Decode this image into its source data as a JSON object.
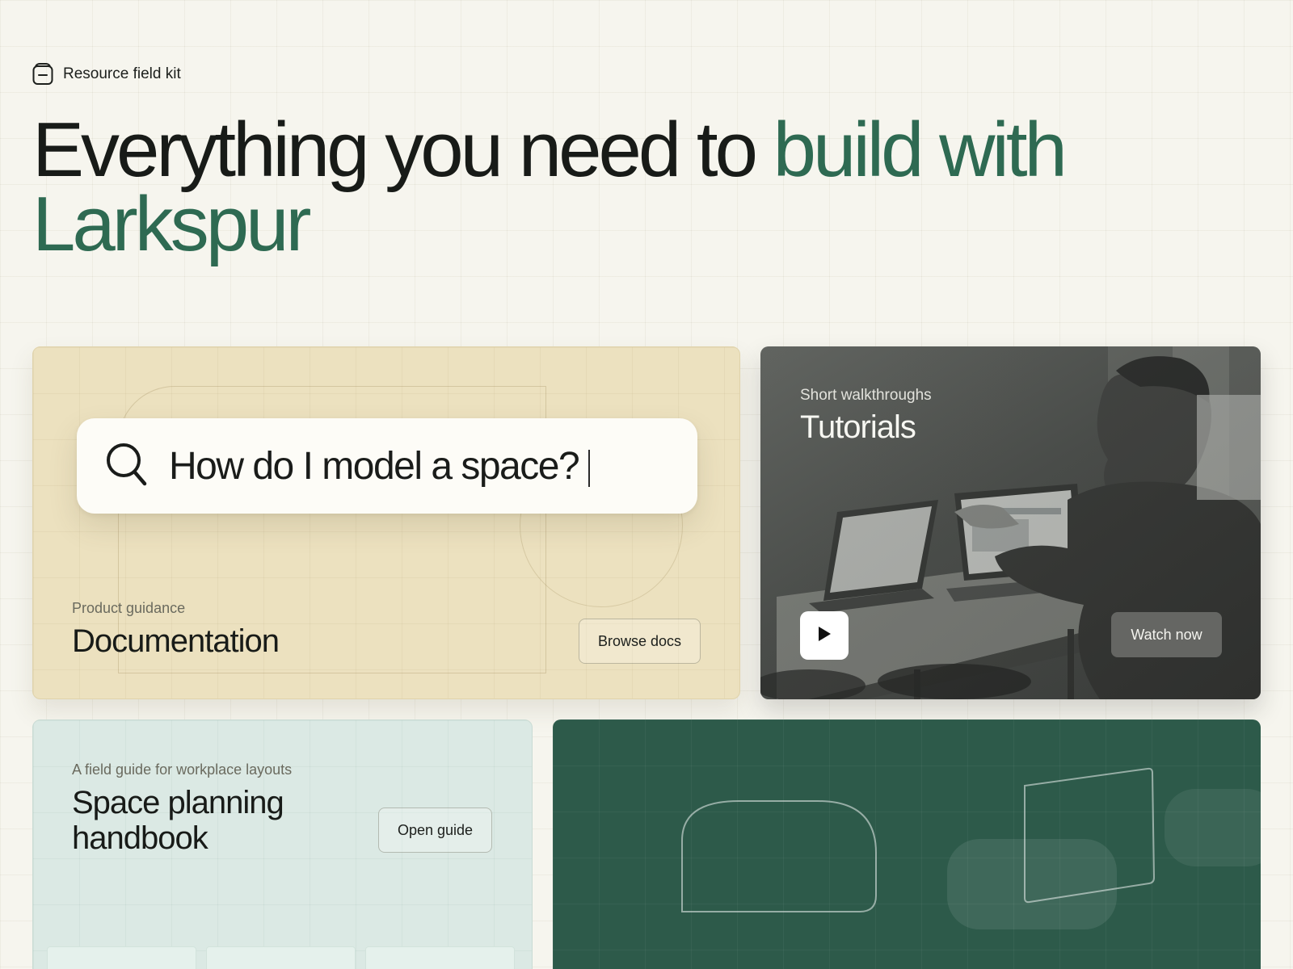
{
  "brand": {
    "icon": "archive-box-icon",
    "label": "Resource field kit"
  },
  "hero": {
    "headline_plain": "Everything you need to ",
    "headline_accent_1": "build with",
    "headline_accent_2": "Larkspur"
  },
  "documentation_card": {
    "search_query": "How do I model a space?",
    "search_icon": "search-icon",
    "kicker": "Product guidance",
    "title": "Documentation",
    "button_label": "Browse docs"
  },
  "tutorials_card": {
    "kicker": "Short walkthroughs",
    "title": "Tutorials",
    "play_icon": "play-icon",
    "button_label": "Watch now"
  },
  "handbook_card": {
    "kicker": "A field guide for workplace layouts",
    "title_line_1": "Space planning",
    "title_line_2": "handbook",
    "button_label": "Open guide"
  },
  "colors": {
    "background": "#f6f5ee",
    "accent_green": "#2e6a52",
    "docs_card": "#ece1bf",
    "handbook_card": "#dbe9e4",
    "green_card": "#2d5a4a"
  }
}
